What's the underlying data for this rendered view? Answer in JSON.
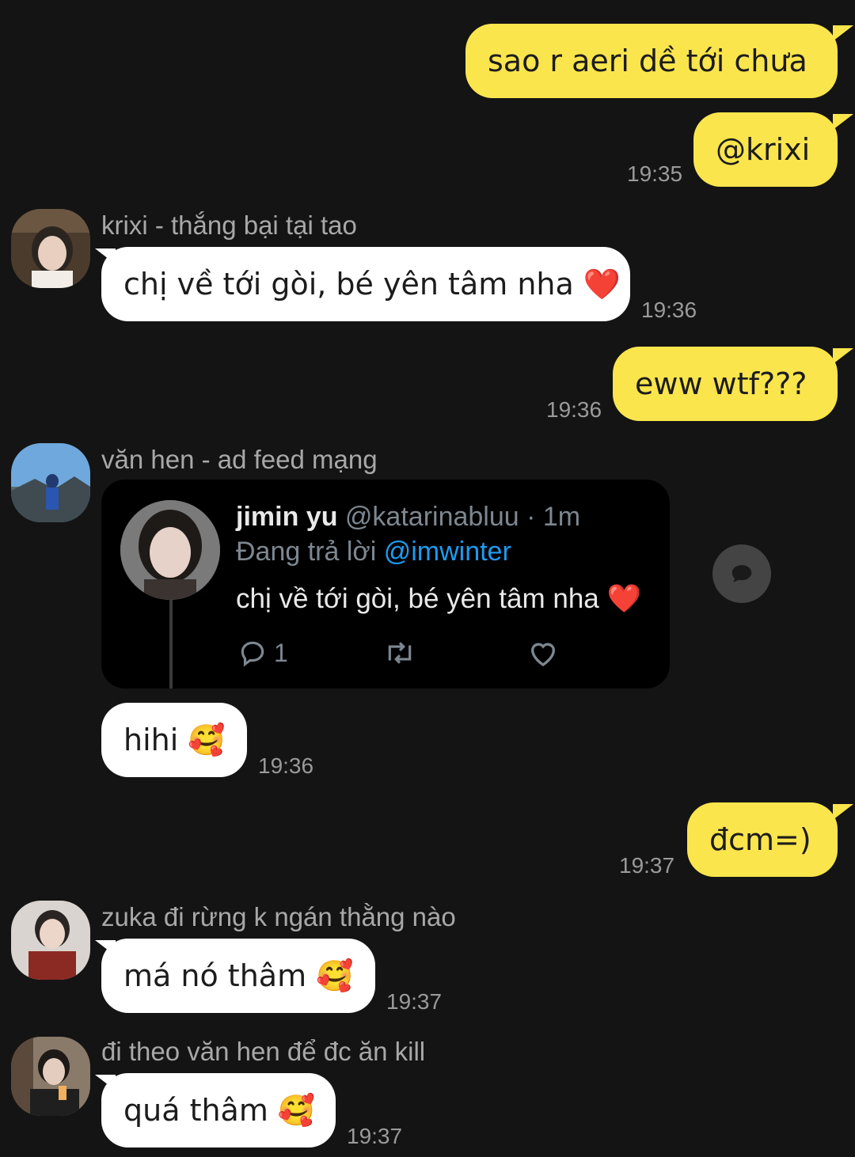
{
  "messages": {
    "m1": {
      "text": "sao r aeri dề tới chưa"
    },
    "m2": {
      "text": "@krixi",
      "time": "19:35"
    },
    "m3": {
      "sender": "krixi - thắng bại tại tao",
      "text": "chị về tới gòi, bé yên tâm nha",
      "emoji": "❤️",
      "time": "19:36"
    },
    "m4": {
      "text": "eww wtf???",
      "time": "19:36"
    },
    "m5": {
      "sender": "văn hen - ad feed mạng"
    },
    "m6": {
      "text": "hihi",
      "emoji": "🥰",
      "time": "19:36"
    },
    "m7": {
      "text": "đcm=)",
      "time": "19:37"
    },
    "m8": {
      "sender": "zuka đi rừng k ngán thằng nào",
      "text": "má nó thâm",
      "emoji": "🥰",
      "time": "19:37"
    },
    "m9": {
      "sender": "đi theo văn hen để đc ăn kill",
      "text": "quá thâm",
      "emoji": "🥰",
      "time": "19:37"
    }
  },
  "tweet": {
    "name": "jimin yu",
    "handle": "@katarinabluu · 1m",
    "reply_prefix": "Đang trả lời ",
    "reply_mention": "@imwinter",
    "body": "chị về tới gòi, bé yên tâm nha ❤️",
    "reply_count": "1"
  },
  "icons": {
    "share": "share-bubble-icon",
    "reply": "reply-icon",
    "retweet": "retweet-icon",
    "like": "heart-icon"
  },
  "colors": {
    "my_bubble": "#fbe54d",
    "their_bubble": "#ffffff",
    "background": "#141414",
    "mention": "#1d9bf0"
  }
}
